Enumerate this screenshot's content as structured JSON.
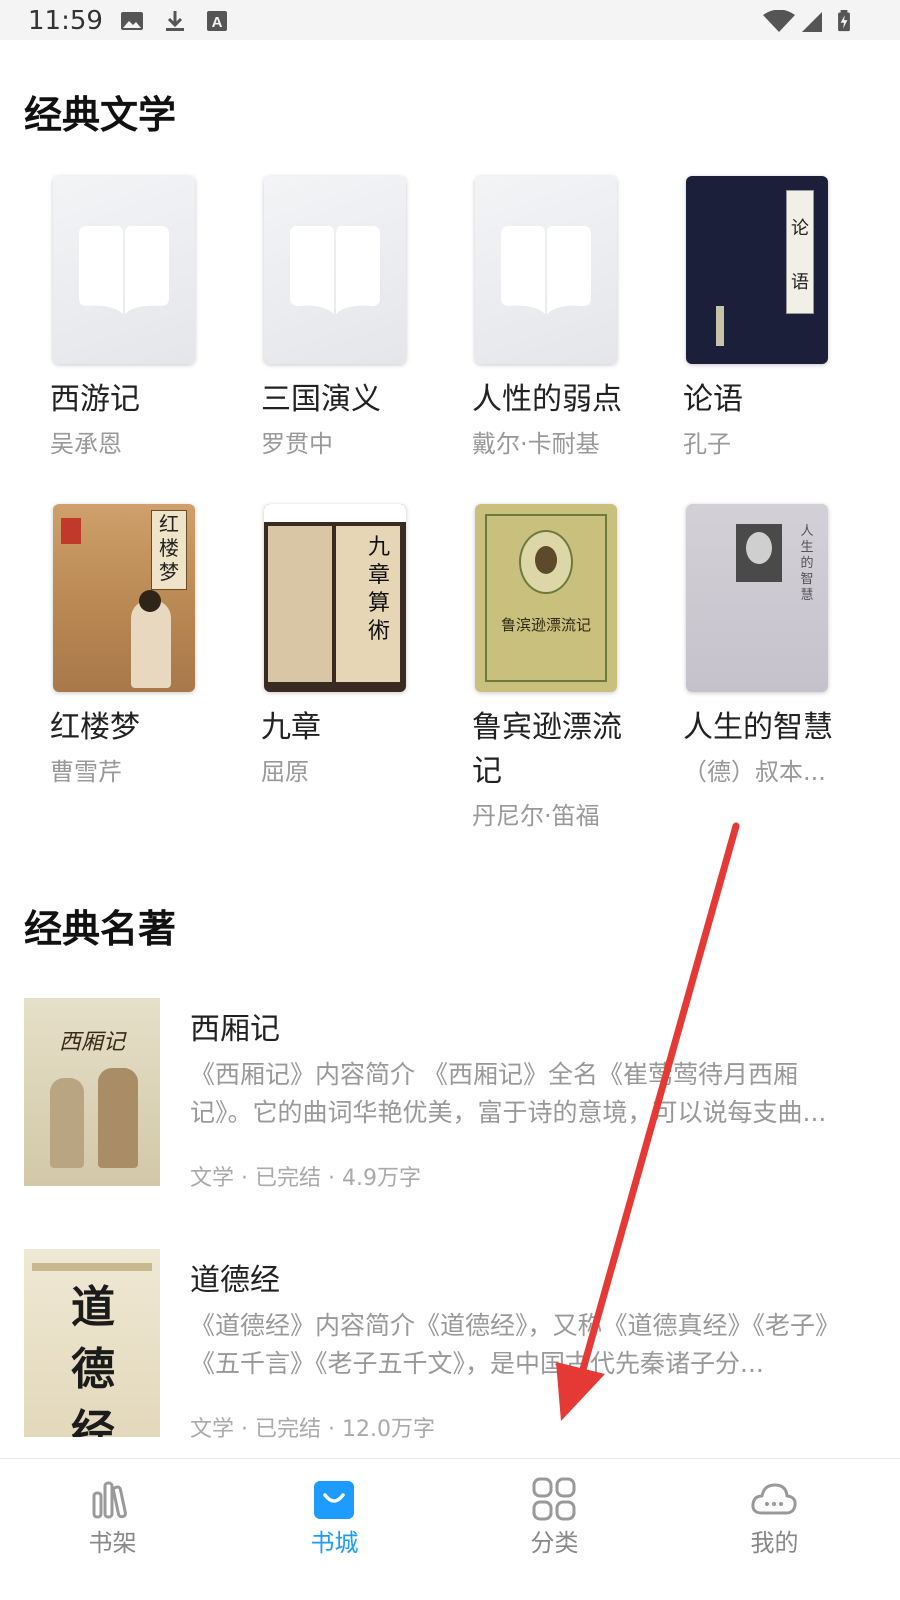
{
  "status_bar": {
    "time": "11:59"
  },
  "sections": {
    "classic_literature": {
      "title": "经典文学",
      "books": [
        {
          "name": "西游记",
          "author": "吴承恩"
        },
        {
          "name": "三国演义",
          "author": "罗贯中"
        },
        {
          "name": "人性的弱点",
          "author": "戴尔·卡耐基"
        },
        {
          "name": "论语",
          "author": "孔子",
          "cover_text": "论 语"
        },
        {
          "name": "红楼梦",
          "author": "曹雪芹",
          "cover_text": "红楼梦"
        },
        {
          "name": "九章",
          "author": "屈原",
          "cover_text": "九章算術"
        },
        {
          "name": "鲁宾逊漂流记",
          "author": "丹尼尔·笛福",
          "cover_text": "鲁滨逊漂流记"
        },
        {
          "name": "人生的智慧",
          "author": "（德）叔本...",
          "cover_text": "人生的智慧"
        }
      ]
    },
    "classic_masterpieces": {
      "title": "经典名著",
      "items": [
        {
          "title": "西厢记",
          "desc": "《西厢记》内容简介 《西厢记》全名《崔莺莺待月西厢记》。它的曲词华艳优美，富于诗的意境，可以说每支曲...",
          "meta": "文学 · 已完结 · 4.9万字",
          "cover_text": "西厢记"
        },
        {
          "title": "道德经",
          "desc": "《道德经》内容简介《道德经》，又称《道德真经》《老子》《五千言》《老子五千文》，是中国古代先秦诸子分...",
          "meta": "文学 · 已完结 · 12.0万字",
          "cover_text": "道德经"
        }
      ]
    }
  },
  "bottom_nav": {
    "items": [
      {
        "label": "书架",
        "icon": "bookshelf-icon"
      },
      {
        "label": "书城",
        "icon": "bag-icon",
        "active": true
      },
      {
        "label": "分类",
        "icon": "grid-icon"
      },
      {
        "label": "我的",
        "icon": "cloud-icon"
      }
    ]
  },
  "colors": {
    "accent": "#1e9bff",
    "annotation_arrow": "#e53935"
  }
}
